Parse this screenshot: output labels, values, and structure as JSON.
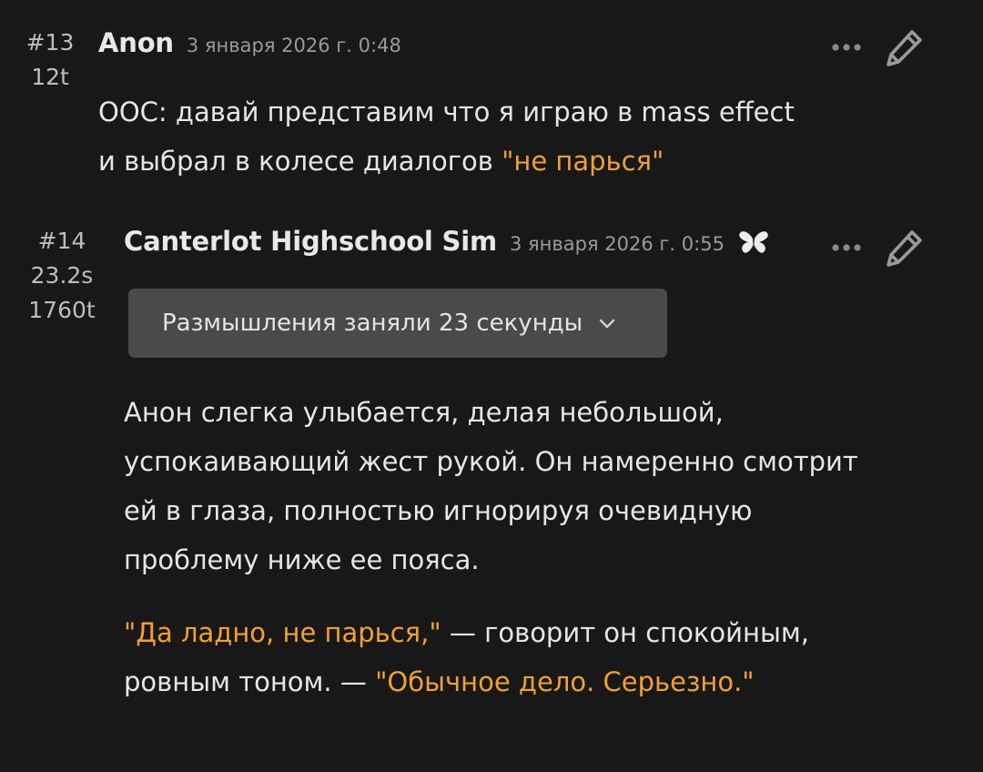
{
  "messages": [
    {
      "number": "#13",
      "stats": [
        "12t"
      ],
      "author": "Anon",
      "timestamp": "3 января 2026 г. 0:48",
      "body": {
        "line1": "OOC: давай представим что я играю в mass effect",
        "line2_plain": "и выбрал в колесе диалогов ",
        "line2_quote": "\"не парься\""
      }
    },
    {
      "number": "#14",
      "stats": [
        "23.2s",
        "1760t"
      ],
      "author": "Canterlot Highschool Sim",
      "timestamp": "3 января 2026 г. 0:55",
      "thinking_label": "Размышления заняли 23 секунды",
      "paragraph1": "Анон слегка улыбается, делая небольшой, успокаивающий жест рукой. Он намеренно смотрит ей в глаза, полностью игнорируя очевидную проблему ниже ее пояса.",
      "paragraph2": {
        "quote1": "\"Да ладно, не парься,\"",
        "plain": " — говорит он спокойным, ровным тоном. — ",
        "quote2": "\"Обычное дело. Серьезно.\""
      }
    }
  ],
  "icons": {
    "menu": "dots-horizontal-icon",
    "edit": "pencil-icon",
    "character": "butterfly-icon",
    "expand": "chevron-down-icon"
  },
  "colors": {
    "background": "#181818",
    "text": "#e6e6e6",
    "quote": "#f0a035",
    "thinking_box": "#4a4a4a",
    "timestamp": "#9a9a9a"
  }
}
